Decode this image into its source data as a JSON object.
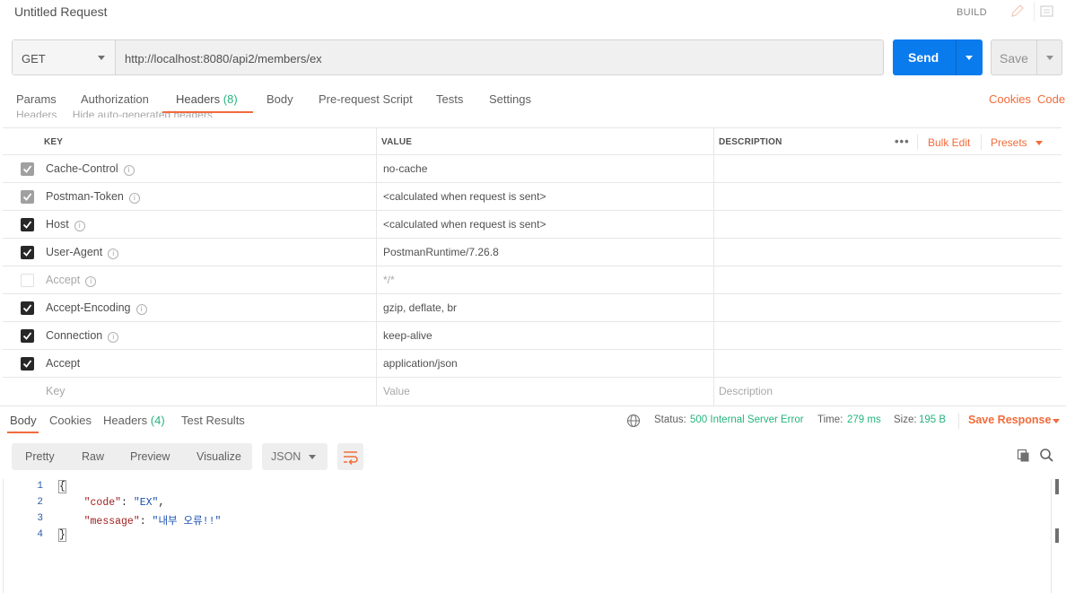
{
  "title_bar": {
    "title": "Untitled Request",
    "build_label": "BUILD"
  },
  "request": {
    "method": "GET",
    "url": "http://localhost:8080/api2/members/ex",
    "send_label": "Send",
    "save_label": "Save"
  },
  "request_tabs": [
    {
      "label": "Params"
    },
    {
      "label": "Authorization"
    },
    {
      "label": "Headers",
      "count": "(8)"
    },
    {
      "label": "Body"
    },
    {
      "label": "Pre-request Script"
    },
    {
      "label": "Tests"
    },
    {
      "label": "Settings"
    }
  ],
  "request_links": {
    "cookies": "Cookies",
    "code": "Code"
  },
  "ghost_row": {
    "headers_label": "Headers",
    "toggle_label": "Hide auto-generated headers"
  },
  "headers_table": {
    "columns": {
      "key": "KEY",
      "value": "VALUE",
      "description": "DESCRIPTION"
    },
    "more": "•••",
    "bulk_edit": "Bulk Edit",
    "presets": "Presets",
    "rows": [
      {
        "key": "Cache-Control",
        "value": "no-cache",
        "checkbox": "locked",
        "info": true
      },
      {
        "key": "Postman-Token",
        "value": "<calculated when request is sent>",
        "checkbox": "locked",
        "info": true
      },
      {
        "key": "Host",
        "value": "<calculated when request is sent>",
        "checkbox": "checked",
        "info": true
      },
      {
        "key": "User-Agent",
        "value": "PostmanRuntime/7.26.8",
        "checkbox": "checked",
        "info": true
      },
      {
        "key": "Accept",
        "value": "*/*",
        "checkbox": "unchecked",
        "info": true
      },
      {
        "key": "Accept-Encoding",
        "value": "gzip, deflate, br",
        "checkbox": "checked",
        "info": true
      },
      {
        "key": "Connection",
        "value": "keep-alive",
        "checkbox": "checked",
        "info": true
      },
      {
        "key": "Accept",
        "value": "application/json",
        "checkbox": "checked",
        "info": false
      }
    ],
    "placeholders": {
      "key": "Key",
      "value": "Value",
      "description": "Description"
    }
  },
  "response_tabs": [
    {
      "label": "Body"
    },
    {
      "label": "Cookies"
    },
    {
      "label": "Headers",
      "count": "(4)"
    },
    {
      "label": "Test Results"
    }
  ],
  "response_meta": {
    "status_label": "Status:",
    "status_value": "500 Internal Server Error",
    "time_label": "Time:",
    "time_value": "279 ms",
    "size_label": "Size:",
    "size_value": "195 B",
    "save_response": "Save Response"
  },
  "view_modes": {
    "pretty": "Pretty",
    "raw": "Raw",
    "preview": "Preview",
    "visualize": "Visualize"
  },
  "format": "JSON",
  "code": {
    "line_numbers": [
      "1",
      "2",
      "3",
      "4"
    ],
    "open_brace": "{",
    "close_brace": "}",
    "indent": "    ",
    "code_key": "\"code\"",
    "code_value": "\"EX\"",
    "message_key": "\"message\"",
    "message_value": "\"내부 오류!!\"",
    "colon": ": ",
    "comma": ","
  },
  "colors": {
    "accent": "#f26b3a",
    "send_blue": "#097bed",
    "status_green": "#26b47f"
  }
}
